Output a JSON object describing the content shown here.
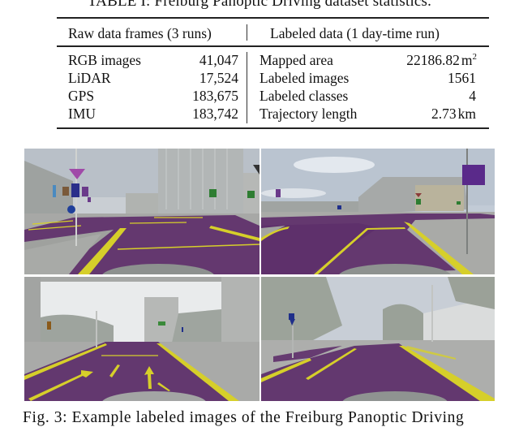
{
  "table": {
    "title": "TABLE I: Freiburg Panoptic Driving dataset statistics.",
    "left_header": "Raw data frames (3 runs)",
    "right_header": "Labeled data (1 day-time run)",
    "left_rows": [
      {
        "label": "RGB images",
        "value": "41,047"
      },
      {
        "label": "LiDAR",
        "value": "17,524"
      },
      {
        "label": "GPS",
        "value": "183,675"
      },
      {
        "label": "IMU",
        "value": "183,742"
      }
    ],
    "right_rows": [
      {
        "label": "Mapped area",
        "value": "22186.82",
        "unit": "m",
        "unit_sup": "2"
      },
      {
        "label": "Labeled images",
        "value": "1561",
        "unit": "",
        "unit_sup": ""
      },
      {
        "label": "Labeled classes",
        "value": "4",
        "unit": "",
        "unit_sup": ""
      },
      {
        "label": "Trajectory length",
        "value": "2.73",
        "unit": "km",
        "unit_sup": ""
      }
    ]
  },
  "figure": {
    "images": [
      {
        "name": "intersection-office-tower",
        "description": "Labeled road intersection with tall glass office building"
      },
      {
        "name": "roundabout-office-block",
        "description": "Labeled roundabout approach with office block"
      },
      {
        "name": "road-under-bridge",
        "description": "Labeled road with arrow markings under a bridge"
      },
      {
        "name": "tree-lined-street",
        "description": "Labeled tree-lined street with white building"
      }
    ],
    "colors": {
      "road": "#5e2f6a",
      "lane_marking": "#d6cf2a",
      "sign_purple": "#7a3aa0",
      "sign_green": "#2e7d32",
      "sign_blue": "#1f2f8a",
      "background": "#a8aaa8"
    },
    "caption": "Fig. 3: Example labeled images of the Freiburg Panoptic Driving"
  }
}
